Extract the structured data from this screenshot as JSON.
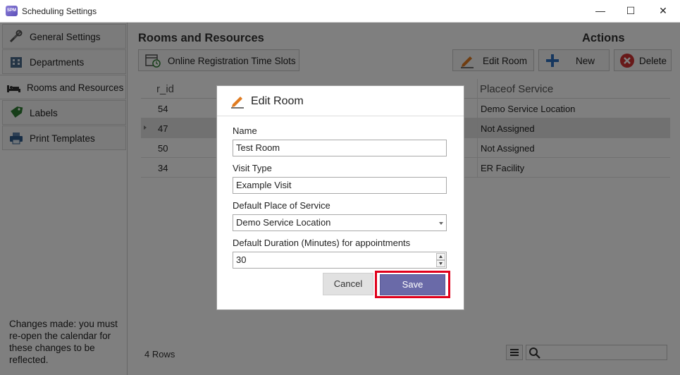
{
  "window": {
    "title": "Scheduling Settings",
    "app_icon_text": "SPM",
    "minimize": "—",
    "maximize": "☐",
    "close": "✕"
  },
  "sidebar": {
    "items": [
      {
        "label": "General Settings",
        "icon": "tools-icon"
      },
      {
        "label": "Departments",
        "icon": "building-icon"
      },
      {
        "label": "Rooms and Resources",
        "icon": "bed-icon"
      },
      {
        "label": "Labels",
        "icon": "tag-icon"
      },
      {
        "label": "Print Templates",
        "icon": "printer-icon"
      }
    ],
    "active_index": 2,
    "note": "Changes made: you must re-open the calendar for these changes to be reflected."
  },
  "main": {
    "section_title": "Rooms and Resources",
    "actions_title": "Actions",
    "toolbar": {
      "time_slots_label": "Online Registration Time Slots",
      "edit_label": "Edit Room",
      "new_label": "New",
      "delete_label": "Delete"
    },
    "grid": {
      "columns": [
        "r_id",
        "Placeof Service"
      ],
      "rows": [
        {
          "id": "54",
          "place": "Demo Service Location"
        },
        {
          "id": "47",
          "place": "Not Assigned"
        },
        {
          "id": "50",
          "place": "Not Assigned"
        },
        {
          "id": "34",
          "place": "ER Facility"
        }
      ],
      "selected_index": 1
    },
    "footer": {
      "row_count": "4 Rows"
    }
  },
  "modal": {
    "title": "Edit Room",
    "name_label": "Name",
    "name_value": "Test Room",
    "visit_type_label": "Visit Type",
    "visit_type_value": "Example Visit",
    "place_label": "Default Place of Service",
    "place_value": "Demo Service Location",
    "duration_label": "Default Duration (Minutes) for appointments",
    "duration_value": "30",
    "cancel_label": "Cancel",
    "save_label": "Save",
    "highlight_color": "#e0001b"
  },
  "colors": {
    "accent": "#6a6aa8",
    "overlay": "rgba(0,0,0,0.5)",
    "new_icon": "#2d6fbf",
    "delete_icon": "#d13232"
  }
}
